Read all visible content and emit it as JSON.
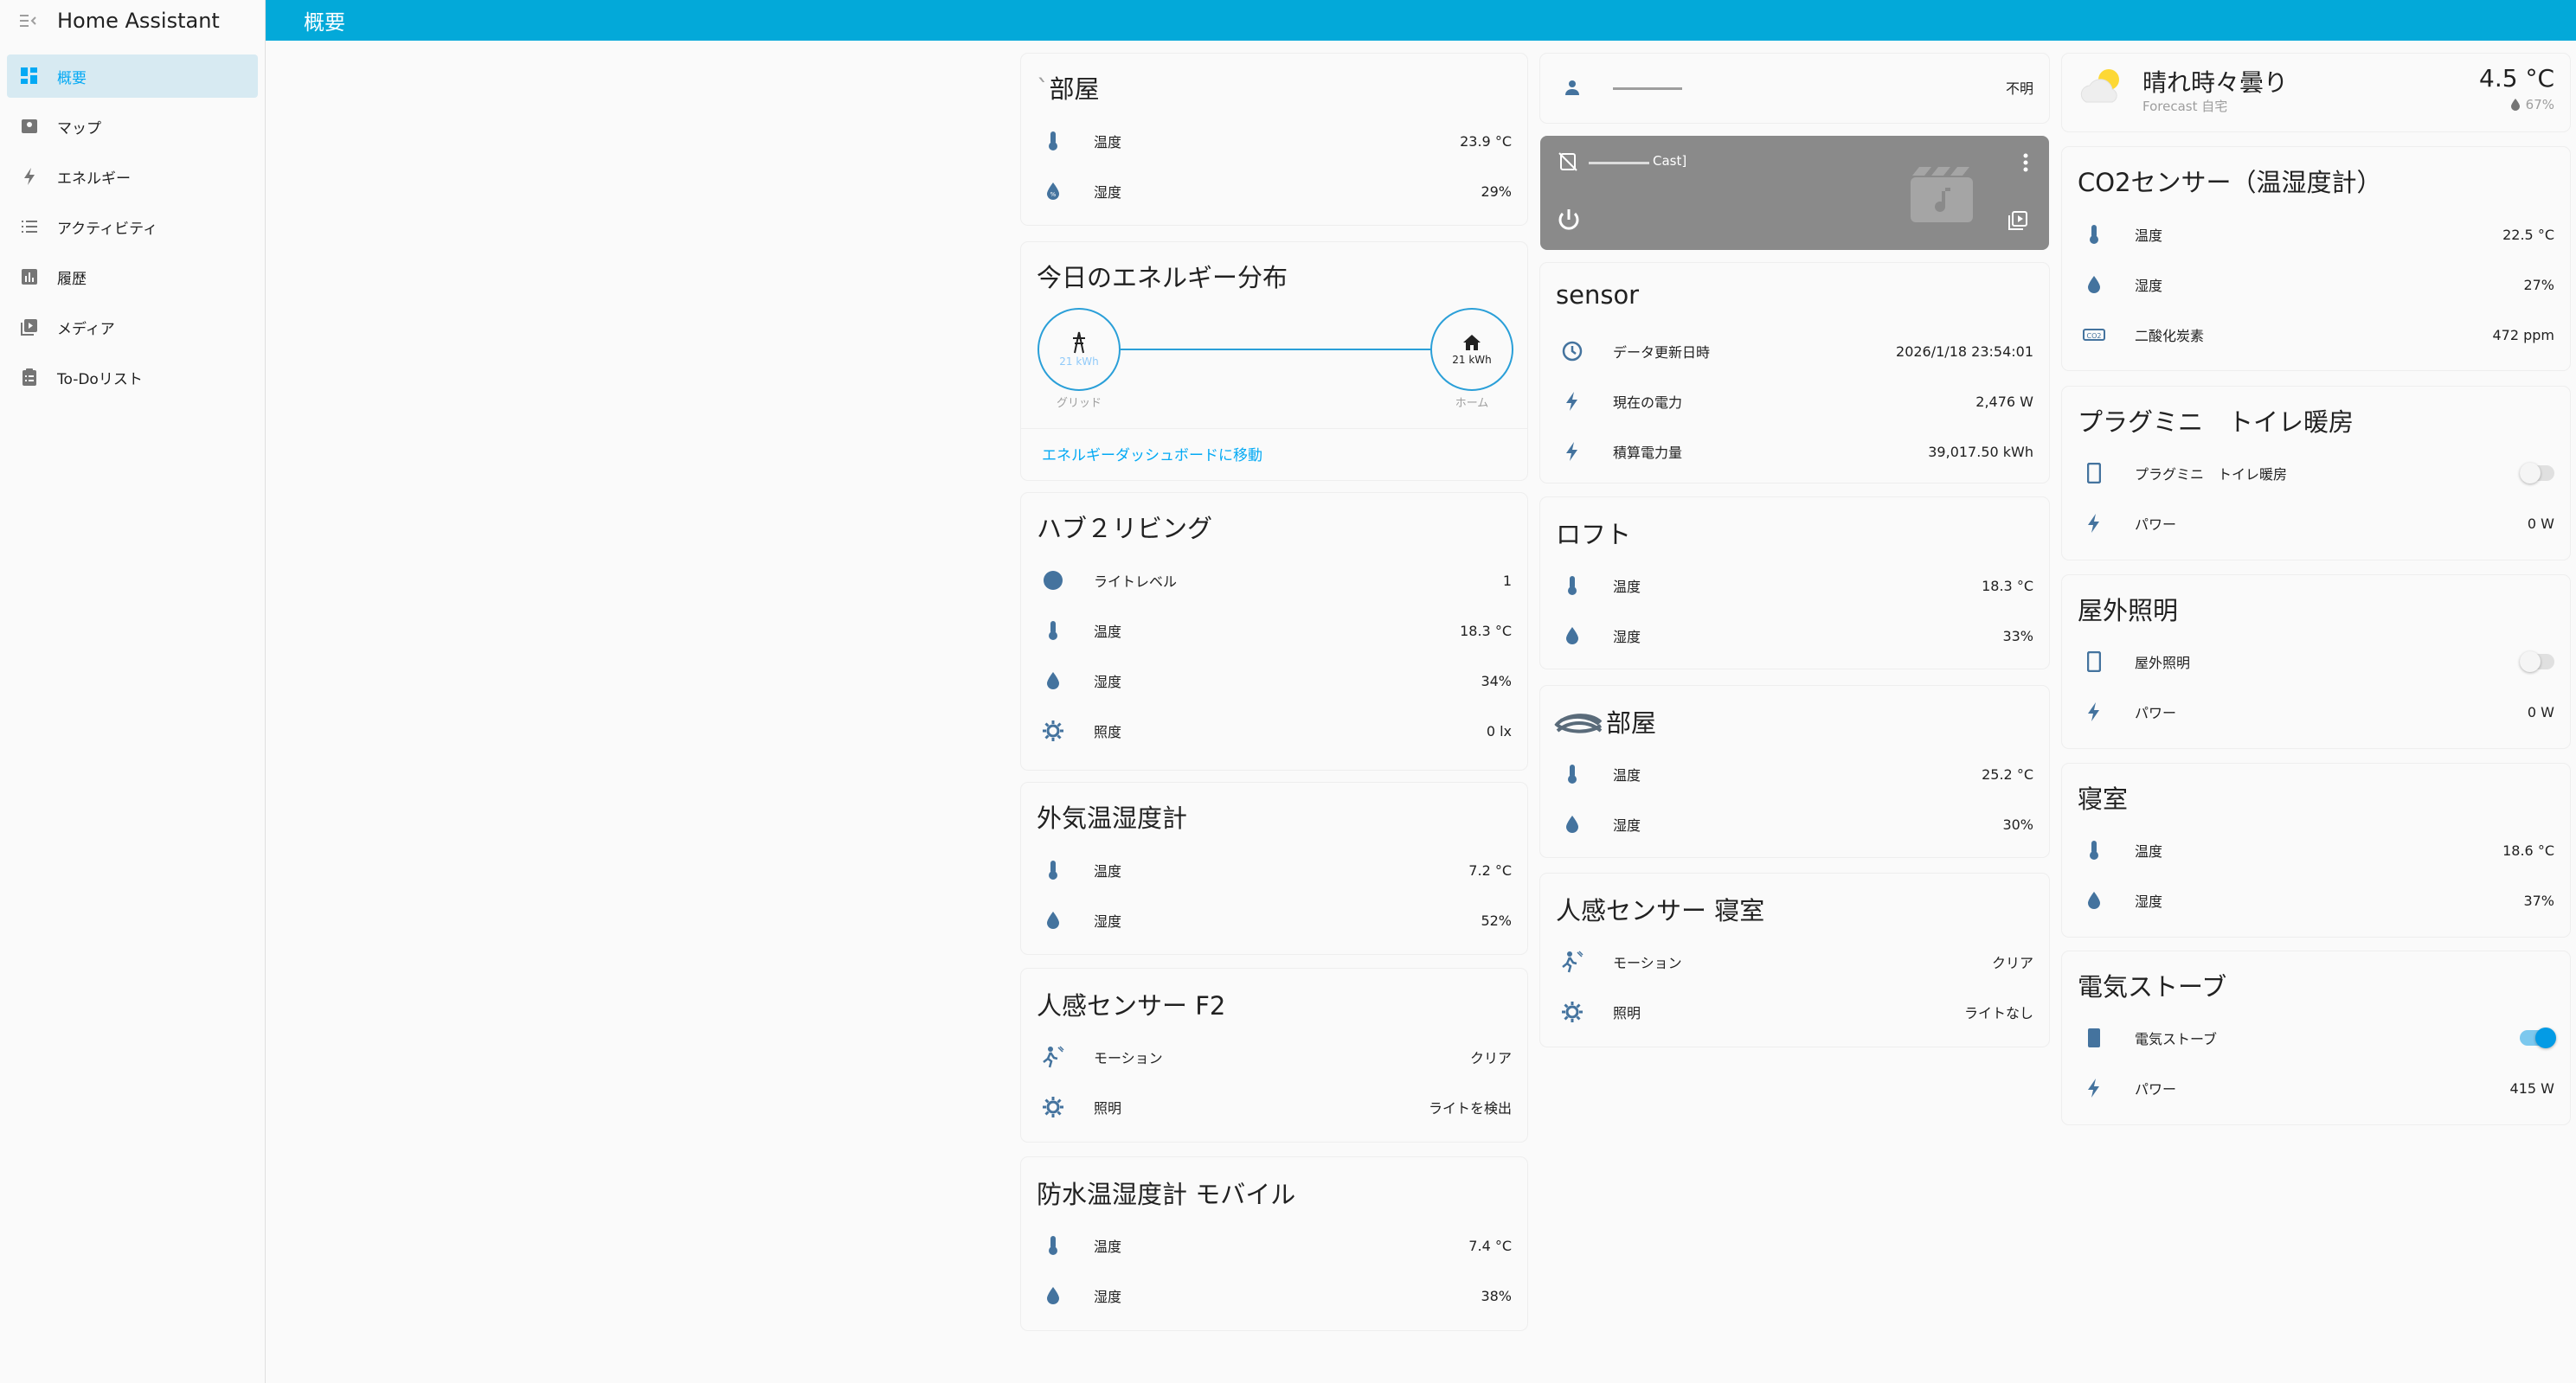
{
  "app": {
    "title": "Home Assistant"
  },
  "topbar": {
    "title": "概要"
  },
  "sidebar": {
    "items": [
      {
        "label": "概要",
        "icon": "dashboard-icon",
        "active": true
      },
      {
        "label": "マップ",
        "icon": "map-icon"
      },
      {
        "label": "エネルギー",
        "icon": "lightning-icon"
      },
      {
        "label": "アクティビティ",
        "icon": "list-icon"
      },
      {
        "label": "履歴",
        "icon": "chart-icon"
      },
      {
        "label": "メディア",
        "icon": "media-icon"
      },
      {
        "label": "To-Doリスト",
        "icon": "clipboard-icon"
      }
    ]
  },
  "col1": {
    "room": {
      "title": "部屋",
      "rows": [
        {
          "label": "温度",
          "value": "23.9 °C"
        },
        {
          "label": "湿度",
          "value": "29%"
        }
      ]
    },
    "energy": {
      "title": "今日のエネルギー分布",
      "grid_value": "21 kWh",
      "grid_label": "グリッド",
      "home_value": "21 kWh",
      "home_label": "ホーム",
      "link": "エネルギーダッシュボードに移動"
    },
    "hub": {
      "title": "ハブ２リビング",
      "rows": [
        {
          "label": "ライトレベル",
          "value": "1"
        },
        {
          "label": "温度",
          "value": "18.3 °C"
        },
        {
          "label": "湿度",
          "value": "34%"
        },
        {
          "label": "照度",
          "value": "0 lx"
        }
      ]
    },
    "outdoor": {
      "title": "外気温湿度計",
      "rows": [
        {
          "label": "温度",
          "value": "7.2 °C"
        },
        {
          "label": "湿度",
          "value": "52%"
        }
      ]
    },
    "motion_f2": {
      "title": "人感センサー F2",
      "rows": [
        {
          "label": "モーション",
          "value": "クリア"
        },
        {
          "label": "照明",
          "value": "ライトを検出"
        }
      ]
    },
    "waterproof": {
      "title": "防水温湿度計 モバイル",
      "rows": [
        {
          "label": "温度",
          "value": "7.4 °C"
        },
        {
          "label": "湿度",
          "value": "38%"
        }
      ]
    }
  },
  "col2": {
    "person": {
      "value": "不明"
    },
    "media": {
      "name": "Cast]"
    },
    "sensor": {
      "title": "sensor",
      "rows": [
        {
          "label": "データ更新日時",
          "value": "2026/1/18 23:54:01"
        },
        {
          "label": "現在の電力",
          "value": "2,476 W"
        },
        {
          "label": "積算電力量",
          "value": "39,017.50 kWh"
        }
      ]
    },
    "loft": {
      "title": "ロフト",
      "rows": [
        {
          "label": "温度",
          "value": "18.3 °C"
        },
        {
          "label": "湿度",
          "value": "33%"
        }
      ]
    },
    "room2": {
      "title": "部屋",
      "rows": [
        {
          "label": "温度",
          "value": "25.2 °C"
        },
        {
          "label": "湿度",
          "value": "30%"
        }
      ]
    },
    "motion_bed": {
      "title": "人感センサー 寝室",
      "rows": [
        {
          "label": "モーション",
          "value": "クリア"
        },
        {
          "label": "照明",
          "value": "ライトなし"
        }
      ]
    }
  },
  "col3": {
    "weather": {
      "condition": "晴れ時々曇り",
      "sub": "Forecast 自宅",
      "temp": "4.5 °C",
      "humidity": "67%"
    },
    "co2": {
      "title": "CO2センサー（温湿度計）",
      "rows": [
        {
          "label": "温度",
          "value": "22.5 °C"
        },
        {
          "label": "湿度",
          "value": "27%"
        },
        {
          "label": "二酸化炭素",
          "value": "472 ppm"
        }
      ]
    },
    "plugmini": {
      "title": "プラグミニ　トイレ暖房",
      "rows": [
        {
          "label": "プラグミニ　トイレ暖房",
          "toggle": false
        },
        {
          "label": "パワー",
          "value": "0 W"
        }
      ]
    },
    "outdoor_light": {
      "title": "屋外照明",
      "rows": [
        {
          "label": "屋外照明",
          "toggle": false
        },
        {
          "label": "パワー",
          "value": "0 W"
        }
      ]
    },
    "bedroom": {
      "title": "寝室",
      "rows": [
        {
          "label": "温度",
          "value": "18.6 °C"
        },
        {
          "label": "湿度",
          "value": "37%"
        }
      ]
    },
    "stove": {
      "title": "電気ストーブ",
      "rows": [
        {
          "label": "電気ストーブ",
          "toggle": true
        },
        {
          "label": "パワー",
          "value": "415 W"
        }
      ]
    }
  }
}
